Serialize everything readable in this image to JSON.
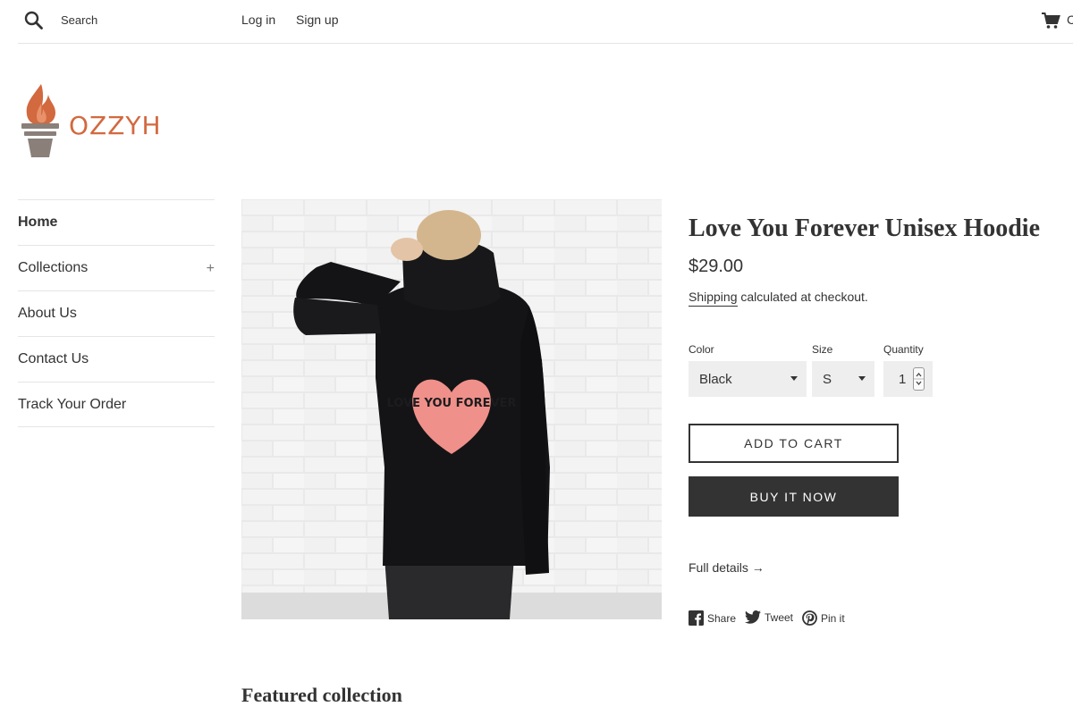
{
  "header": {
    "search_placeholder": "Search",
    "login_label": "Log in",
    "signup_label": "Sign up",
    "cart_label": "C"
  },
  "logo": {
    "text": "OZZYH",
    "color": "#d2693f"
  },
  "sidebar": {
    "items": [
      {
        "label": "Home"
      },
      {
        "label": "Collections",
        "expand": "+"
      },
      {
        "label": "About Us"
      },
      {
        "label": "Contact Us"
      },
      {
        "label": "Track Your Order"
      }
    ]
  },
  "product": {
    "title": "Love You Forever Unisex Hoodie",
    "price": "$29.00",
    "shipping_link": "Shipping",
    "shipping_rest": " calculated at checkout.",
    "image_text": "LOVE YOU FOREVER",
    "options": {
      "color_label": "Color",
      "color_value": "Black",
      "size_label": "Size",
      "size_value": "S",
      "quantity_label": "Quantity",
      "quantity_value": "1"
    },
    "add_to_cart_label": "ADD TO CART",
    "buy_now_label": "BUY IT NOW",
    "full_details_label": "Full details →",
    "share": {
      "facebook": "Share",
      "twitter": "Tweet",
      "pinterest": "Pin it"
    }
  },
  "featured": {
    "title": "Featured collection"
  },
  "colors": {
    "accent": "#d2693f",
    "button_dark": "#333333",
    "select_bg": "#eeeeee",
    "heart_pink": "#f0908a"
  }
}
